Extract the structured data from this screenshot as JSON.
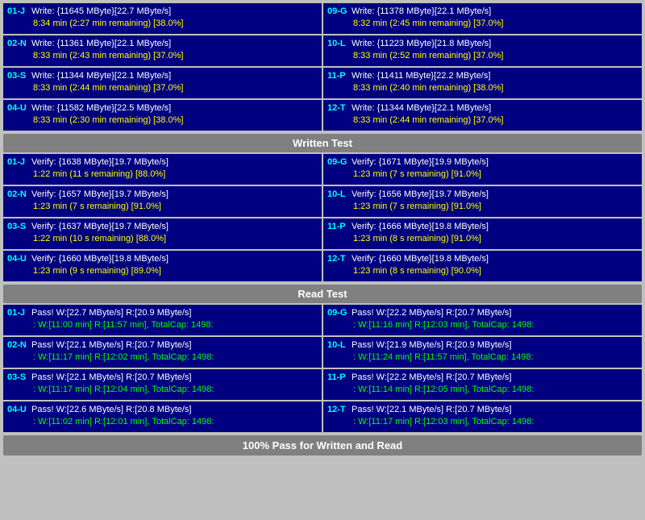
{
  "sections": {
    "written_test": {
      "label": "Written Test",
      "rows_left": [
        {
          "device": "01-J",
          "line1": "Write: {11645 MByte}[22.7 MByte/s]",
          "line2": "8:34 min (2:27 min remaining)  [38.0%]"
        },
        {
          "device": "02-N",
          "line1": "Write: {11361 MByte}[22.1 MByte/s]",
          "line2": "8:33 min (2:43 min remaining)  [37.0%]"
        },
        {
          "device": "03-S",
          "line1": "Write: {11344 MByte}[22.1 MByte/s]",
          "line2": "8:33 min (2:44 min remaining)  [37.0%]"
        },
        {
          "device": "04-U",
          "line1": "Write: {11582 MByte}[22.5 MByte/s]",
          "line2": "8:33 min (2:30 min remaining)  [38.0%]"
        }
      ],
      "rows_right": [
        {
          "device": "09-G",
          "line1": "Write: {11378 MByte}[22.1 MByte/s]",
          "line2": "8:32 min (2:45 min remaining)  [37.0%]"
        },
        {
          "device": "10-L",
          "line1": "Write: {11223 MByte}[21.8 MByte/s]",
          "line2": "8:33 min (2:52 min remaining)  [37.0%]"
        },
        {
          "device": "11-P",
          "line1": "Write: {11411 MByte}[22.2 MByte/s]",
          "line2": "8:33 min (2:40 min remaining)  [38.0%]"
        },
        {
          "device": "12-T",
          "line1": "Write: {11344 MByte}[22.1 MByte/s]",
          "line2": "8:33 min (2:44 min remaining)  [37.0%]"
        }
      ]
    },
    "verify_test": {
      "label": "Written Test",
      "rows_left": [
        {
          "device": "01-J",
          "line1": "Verify: {1638 MByte}[19.7 MByte/s]",
          "line2": "1:22 min (11 s remaining)   [88.0%]"
        },
        {
          "device": "02-N",
          "line1": "Verify: {1657 MByte}[19.7 MByte/s]",
          "line2": "1:23 min (7 s remaining)   [91.0%]"
        },
        {
          "device": "03-S",
          "line1": "Verify: {1637 MByte}[19.7 MByte/s]",
          "line2": "1:22 min (10 s remaining)   [88.0%]"
        },
        {
          "device": "04-U",
          "line1": "Verify: {1660 MByte}[19.8 MByte/s]",
          "line2": "1:23 min (9 s remaining)   [89.0%]"
        }
      ],
      "rows_right": [
        {
          "device": "09-G",
          "line1": "Verify: {1671 MByte}[19.9 MByte/s]",
          "line2": "1:23 min (7 s remaining)   [91.0%]"
        },
        {
          "device": "10-L",
          "line1": "Verify: {1656 MByte}[19.7 MByte/s]",
          "line2": "1:23 min (7 s remaining)   [91.0%]"
        },
        {
          "device": "11-P",
          "line1": "Verify: {1666 MByte}[19.8 MByte/s]",
          "line2": "1:23 min (8 s remaining)   [91.0%]"
        },
        {
          "device": "12-T",
          "line1": "Verify: {1660 MByte}[19.8 MByte/s]",
          "line2": "1:23 min (8 s remaining)   [90.0%]"
        }
      ]
    },
    "read_test_label": "Read Test",
    "read_test": {
      "rows_left": [
        {
          "device": "01-J",
          "line1": "Pass! W:[22.7 MByte/s] R:[20.9 MByte/s]",
          "line2": ": W:[11:00 min] R:[11:57 min], TotalCap: 1498:"
        },
        {
          "device": "02-N",
          "line1": "Pass! W:[22.1 MByte/s] R:[20.7 MByte/s]",
          "line2": ": W:[11:17 min] R:[12:02 min], TotalCap: 1498:"
        },
        {
          "device": "03-S",
          "line1": "Pass! W:[22.1 MByte/s] R:[20.7 MByte/s]",
          "line2": ": W:[11:17 min] R:[12:04 min], TotalCap: 1498:"
        },
        {
          "device": "04-U",
          "line1": "Pass! W:[22.6 MByte/s] R:[20.8 MByte/s]",
          "line2": ": W:[11:02 min] R:[12:01 min], TotalCap: 1498:"
        }
      ],
      "rows_right": [
        {
          "device": "09-G",
          "line1": "Pass! W:[22.2 MByte/s] R:[20.7 MByte/s]",
          "line2": ": W:[11:16 min] R:[12:03 min], TotalCap: 1498:"
        },
        {
          "device": "10-L",
          "line1": "Pass! W:[21.9 MByte/s] R:[20.9 MByte/s]",
          "line2": ": W:[11:24 min] R:[11:57 min], TotalCap: 1498:"
        },
        {
          "device": "11-P",
          "line1": "Pass! W:[22.2 MByte/s] R:[20.7 MByte/s]",
          "line2": ": W:[11:14 min] R:[12:05 min], TotalCap: 1498:"
        },
        {
          "device": "12-T",
          "line1": "Pass! W:[22.1 MByte/s] R:[20.7 MByte/s]",
          "line2": ": W:[11:17 min] R:[12:03 min], TotalCap: 1498:"
        }
      ]
    },
    "bottom_bar": "100% Pass for Written and Read"
  }
}
